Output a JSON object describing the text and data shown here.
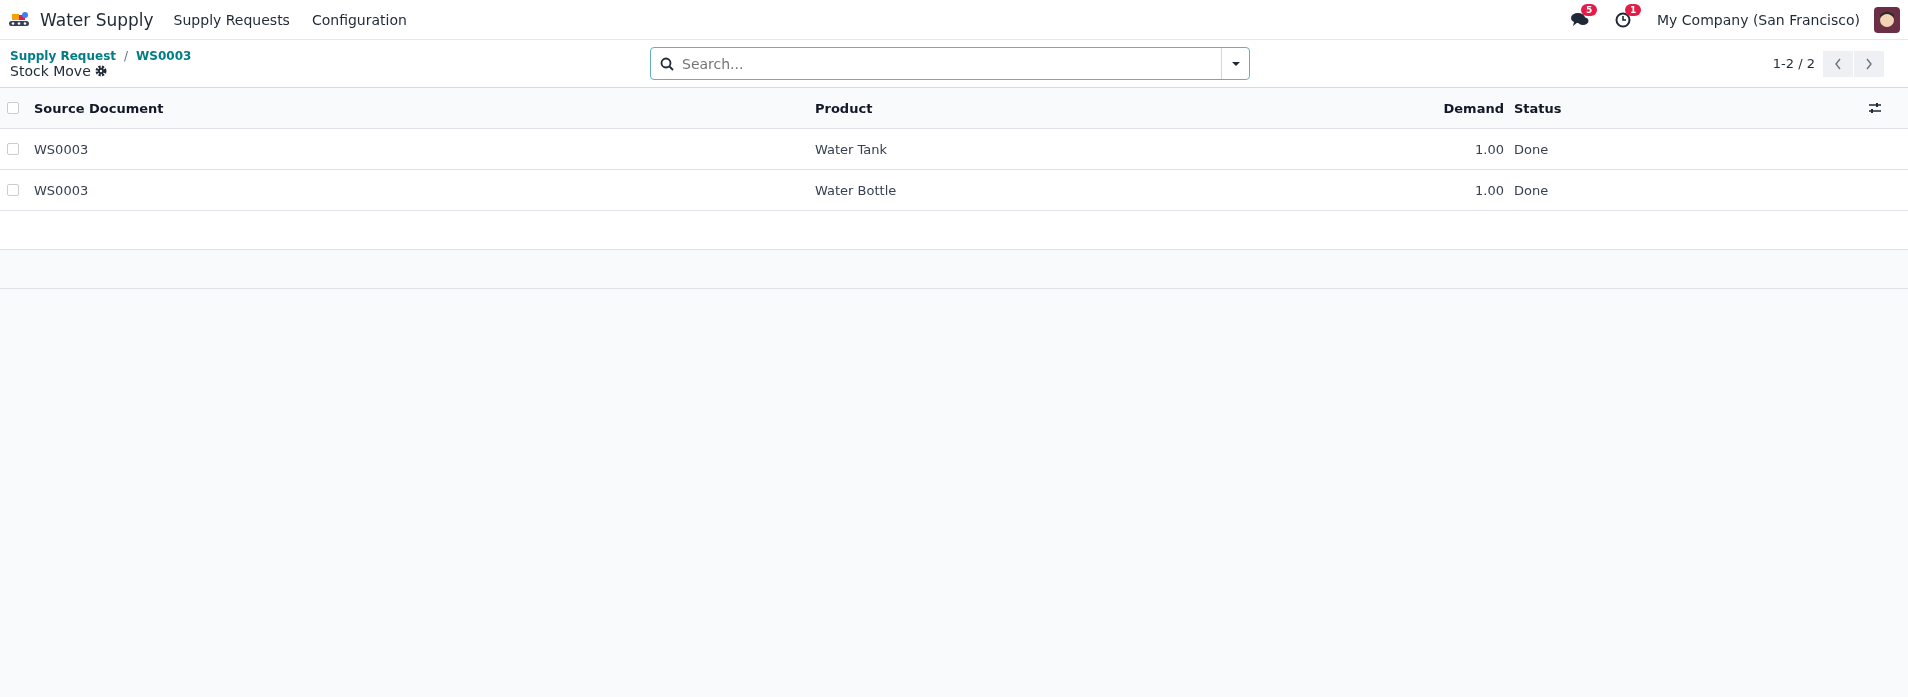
{
  "navbar": {
    "app_name": "Water Supply",
    "menu": [
      "Supply Requests",
      "Configuration"
    ],
    "messages_badge": "5",
    "activities_badge": "1",
    "company": "My Company (San Francisco)"
  },
  "breadcrumb": [
    "Supply Request",
    "WS0003"
  ],
  "breadcrumb_separator": "/",
  "page_title": "Stock Move",
  "search": {
    "placeholder": "Search..."
  },
  "pager": "1-2 / 2",
  "table": {
    "all_selected": false,
    "columns": [
      "Source Document",
      "Product",
      "Demand",
      "Status"
    ],
    "rows": [
      {
        "selected": false,
        "cells": [
          "WS0003",
          "Water Tank",
          "1.00",
          "Done"
        ]
      },
      {
        "selected": false,
        "cells": [
          "WS0003",
          "Water Bottle",
          "1.00",
          "Done"
        ]
      }
    ]
  }
}
